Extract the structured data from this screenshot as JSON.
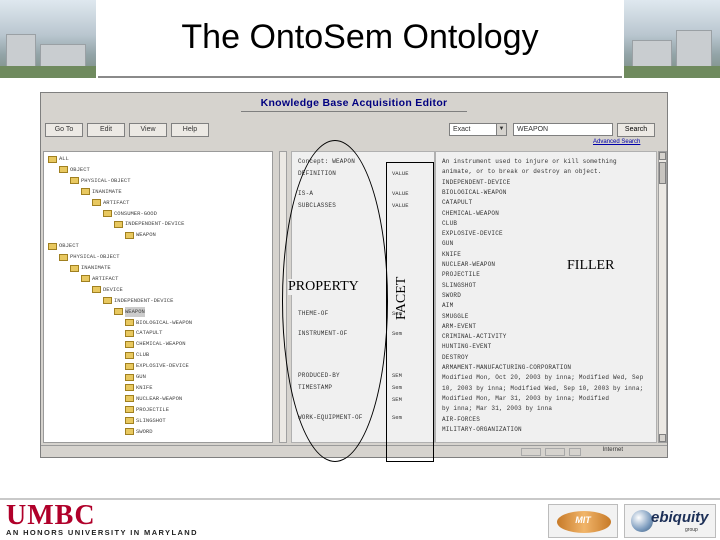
{
  "slide": {
    "title": "The OntoSem Ontology"
  },
  "window": {
    "title": "Knowledge Base Acquisition Editor",
    "toolbar": {
      "buttons": [
        "Go To",
        "Edit",
        "View",
        "Help"
      ],
      "search_mode": "Exact",
      "search_value": "WEAPON",
      "search_label": "Search",
      "advanced_link": "Advanced Search"
    },
    "tree": [
      {
        "label": "ALL",
        "depth": 0
      },
      {
        "label": "OBJECT",
        "depth": 1
      },
      {
        "label": "PHYSICAL-OBJECT",
        "depth": 2
      },
      {
        "label": "INANIMATE",
        "depth": 3
      },
      {
        "label": "ARTIFACT",
        "depth": 4
      },
      {
        "label": "CONSUMER-GOOD",
        "depth": 5
      },
      {
        "label": "INDEPENDENT-DEVICE",
        "depth": 6
      },
      {
        "label": "WEAPON",
        "depth": 7
      },
      {
        "label": "OBJECT",
        "depth": 0
      },
      {
        "label": "PHYSICAL-OBJECT",
        "depth": 1
      },
      {
        "label": "INANIMATE",
        "depth": 2
      },
      {
        "label": "ARTIFACT",
        "depth": 3
      },
      {
        "label": "DEVICE",
        "depth": 4
      },
      {
        "label": "INDEPENDENT-DEVICE",
        "depth": 5
      },
      {
        "label": "WEAPON",
        "depth": 6,
        "selected": true
      },
      {
        "label": "BIOLOGICAL-WEAPON",
        "depth": 7
      },
      {
        "label": "CATAPULT",
        "depth": 7
      },
      {
        "label": "CHEMICAL-WEAPON",
        "depth": 7
      },
      {
        "label": "CLUB",
        "depth": 7
      },
      {
        "label": "EXPLOSIVE-DEVICE",
        "depth": 7
      },
      {
        "label": "GUN",
        "depth": 7
      },
      {
        "label": "KNIFE",
        "depth": 7
      },
      {
        "label": "NUCLEAR-WEAPON",
        "depth": 7
      },
      {
        "label": "PROJECTILE",
        "depth": 7
      },
      {
        "label": "SLINGSHOT",
        "depth": 7
      },
      {
        "label": "SWORD",
        "depth": 7
      }
    ],
    "properties": [
      {
        "name": "Concept: WEAPON",
        "facet": ""
      },
      {
        "name": "DEFINITION",
        "facet": "VALUE"
      },
      {
        "name": "IS-A",
        "facet": "VALUE"
      },
      {
        "name": "SUBCLASSES",
        "facet": "VALUE"
      },
      {
        "name": "THEME-OF",
        "facet": "Sem"
      },
      {
        "name": "INSTRUMENT-OF",
        "facet": "Sem"
      },
      {
        "name": "PRODUCED-BY",
        "facet": "SEM"
      },
      {
        "name": "TIMESTAMP",
        "facet": "Sem"
      },
      {
        "name": "",
        "facet": "SEM"
      },
      {
        "name": "WORK-EQUIPMENT-OF",
        "facet": "Sem"
      }
    ],
    "fillers": [
      "An instrument used to injure or kill something",
      "animate, or to break or destroy an object.",
      "INDEPENDENT-DEVICE",
      "BIOLOGICAL-WEAPON",
      "CATAPULT",
      "CHEMICAL-WEAPON",
      "CLUB",
      "EXPLOSIVE-DEVICE",
      "GUN",
      "KNIFE",
      "NUCLEAR-WEAPON",
      "PROJECTILE",
      "SLINGSHOT",
      "SWORD",
      "AIM",
      "SMUGGLE",
      "ARM-EVENT",
      "CRIMINAL-ACTIVITY",
      "HUNTING-EVENT",
      "DESTROY",
      "ARMAMENT-MANUFACTURING-CORPORATION",
      "Modified Mon, Oct 20, 2003 by inna; Modified Wed, Sep",
      "10, 2003 by inna; Modified Wed, Sep 10, 2003 by inna;",
      "Modified Mon, Mar 31, 2003 by inna; Modified",
      "by inna; Mar 31, 2003 by inna",
      "AIR-FORCES",
      "MILITARY-ORGANIZATION"
    ],
    "status_text": "Internet"
  },
  "annotations": {
    "property": "PROPERTY",
    "facet": "FACET",
    "filler": "FILLER"
  },
  "footer": {
    "logo": "UMBC",
    "tagline": "AN HONORS UNIVERSITY IN MARYLAND",
    "partner_logo_1": "MIT",
    "partner_logo_2": "ebiquity",
    "partner_logo_2_sub": "group"
  },
  "colors": {
    "umbc_red": "#b0002a",
    "window_title": "#000080",
    "window_bg": "#d6d3ce"
  }
}
